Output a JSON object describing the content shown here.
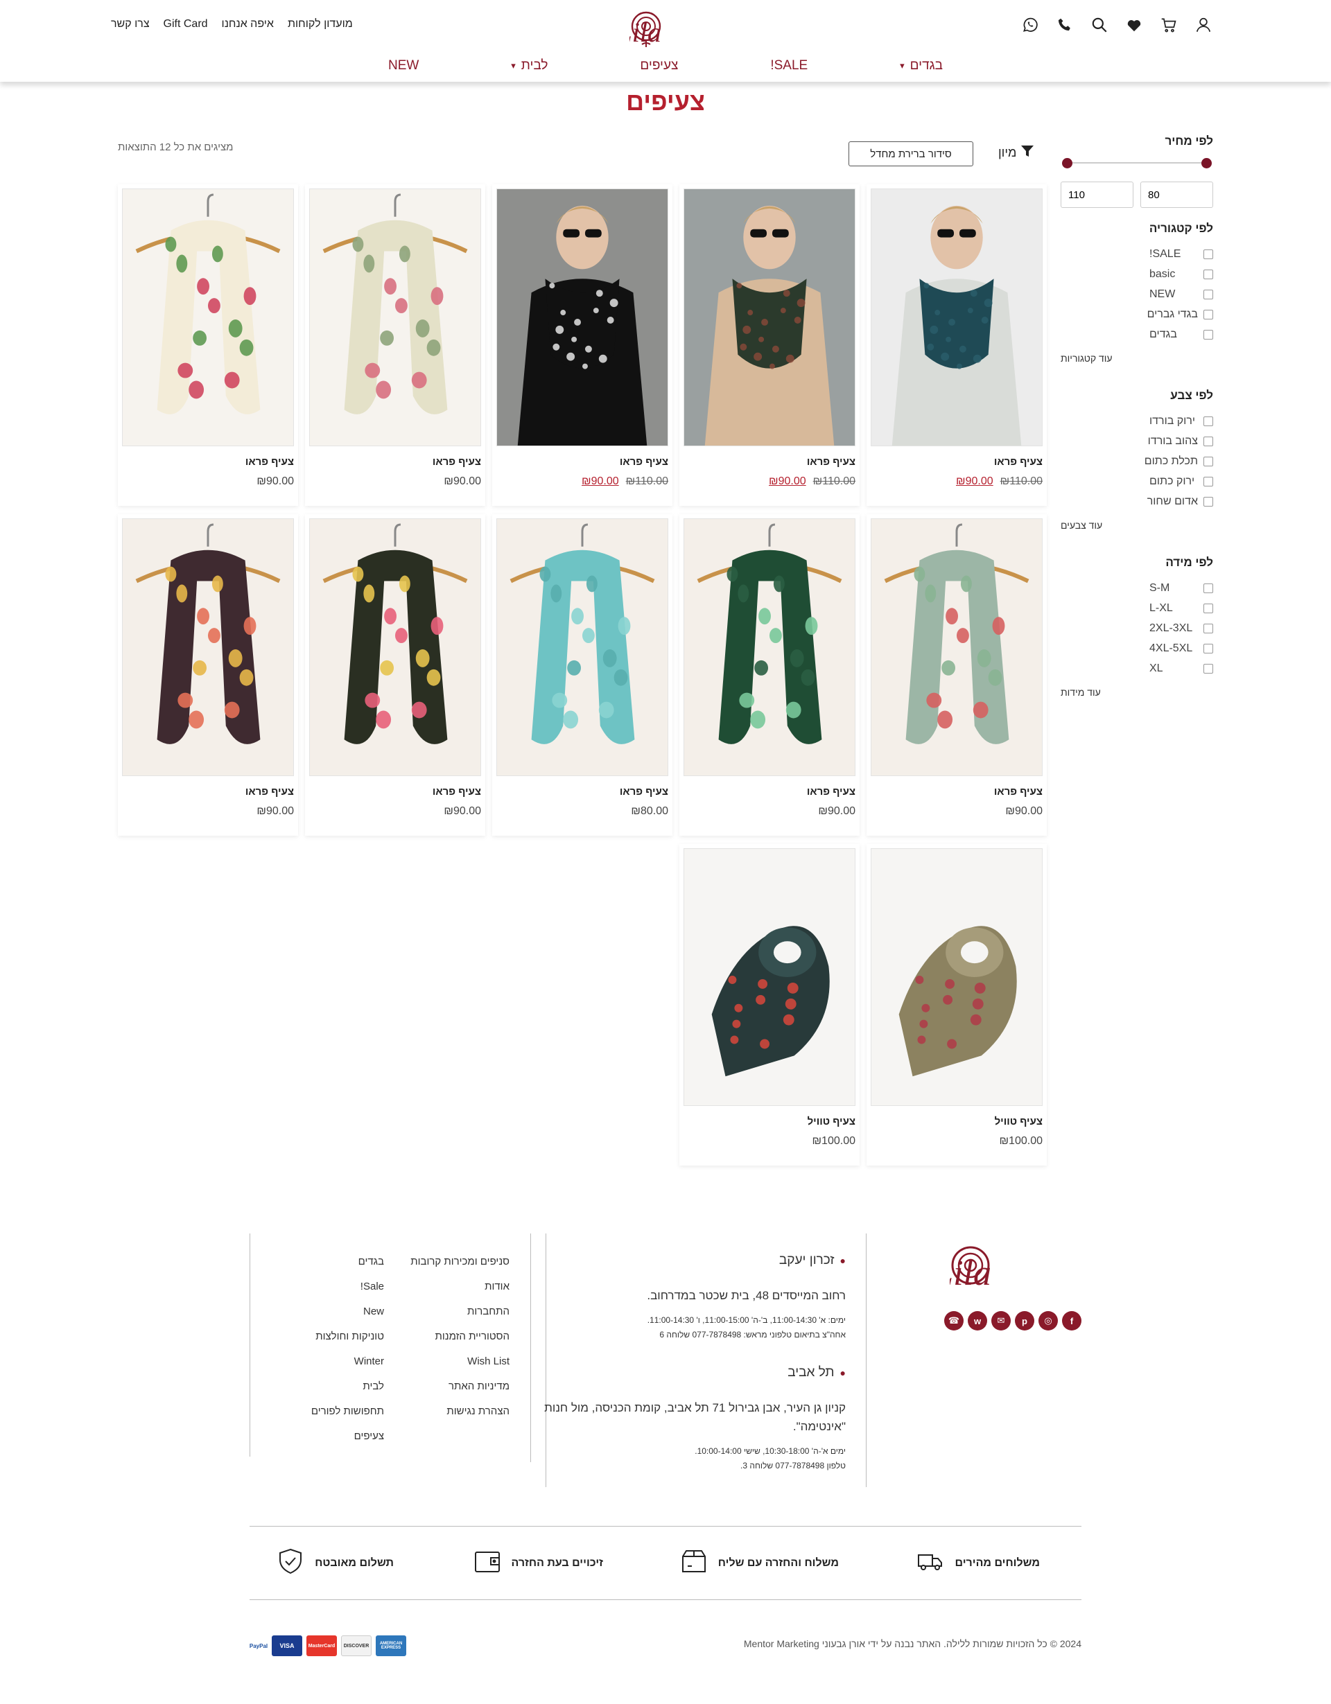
{
  "header": {
    "logo_text": "Lila",
    "util_links": [
      "מועדון לקוחות",
      "איפה אנחנו",
      "Gift Card",
      "צרו קשר"
    ],
    "nav": [
      {
        "label": "בגדים",
        "dropdown": true
      },
      {
        "label": "SALE!",
        "dropdown": false
      },
      {
        "label": "צעיפים",
        "dropdown": false
      },
      {
        "label": "לבית",
        "dropdown": true
      },
      {
        "label": "NEW",
        "dropdown": false
      }
    ],
    "icons": [
      "user-icon",
      "cart-icon",
      "heart-icon",
      "search-icon",
      "phone-icon",
      "whatsapp-icon"
    ]
  },
  "page": {
    "title": "צעיפים",
    "results_count": "מציגים את כל 12 התוצאות",
    "sort_label": "מיון",
    "sort_value": "סידור ברירת מחדל"
  },
  "filters": {
    "price": {
      "title": "לפי מחיר",
      "min": "80",
      "max": "110"
    },
    "category": {
      "title": "לפי קטגוריה",
      "items": [
        "SALE!",
        "basic",
        "NEW",
        "בגדי גברים",
        "בגדים"
      ],
      "more": "עוד קטגוריות"
    },
    "color": {
      "title": "לפי צבע",
      "items": [
        "ירוק בורדו",
        "צהוב בורדו",
        "תכלת כתום",
        "ירוק כתום",
        "אדום שחור"
      ],
      "more": "עוד צבעים"
    },
    "size": {
      "title": "לפי מידה",
      "items": [
        "S-M",
        "L-XL",
        "2XL-3XL",
        "4XL-5XL",
        "XL"
      ],
      "more": "עוד מידות"
    }
  },
  "products": [
    {
      "name": "צעיף פראו",
      "old_price": "₪110.00",
      "price": "₪90.00",
      "on_sale": true,
      "image": "teal dotted scarf on model"
    },
    {
      "name": "צעיף פראו",
      "old_price": "₪110.00",
      "price": "₪90.00",
      "on_sale": true,
      "image": "floral print scarf on model"
    },
    {
      "name": "צעיף פראו",
      "old_price": "₪110.00",
      "price": "₪90.00",
      "on_sale": true,
      "image": "black white checked scarf on model"
    },
    {
      "name": "צעיף פראו",
      "old_price": "",
      "price": "₪90.00",
      "on_sale": false,
      "image": "cream floral scarf on hanger"
    },
    {
      "name": "צעיף פראו",
      "old_price": "",
      "price": "₪90.00",
      "on_sale": false,
      "image": "pink rose scarf on hanger"
    },
    {
      "name": "צעיף פראו",
      "old_price": "",
      "price": "₪90.00",
      "on_sale": false,
      "image": "mint floral scarf on hanger"
    },
    {
      "name": "צעיף פראו",
      "old_price": "",
      "price": "₪90.00",
      "on_sale": false,
      "image": "dark green floral scarf on hanger"
    },
    {
      "name": "צעיף פראו",
      "old_price": "",
      "price": "₪80.00",
      "on_sale": false,
      "image": "turquoise scarf on hanger"
    },
    {
      "name": "צעיף פראו",
      "old_price": "",
      "price": "₪90.00",
      "on_sale": false,
      "image": "geometric pink yellow scarf on hanger"
    },
    {
      "name": "צעיף פראו",
      "old_price": "",
      "price": "₪90.00",
      "on_sale": false,
      "image": "geometric dark scarf on hanger"
    },
    {
      "name": "צעיף טוויל",
      "old_price": "",
      "price": "₪100.00",
      "on_sale": false,
      "image": "olive floral twill scarf"
    },
    {
      "name": "צעיף טוויל",
      "old_price": "",
      "price": "₪100.00",
      "on_sale": false,
      "image": "dark floral twill scarf"
    }
  ],
  "footer": {
    "logo_text": "Lila",
    "socials": [
      "facebook-icon",
      "instagram-icon",
      "pinterest-icon",
      "email-icon",
      "whatsapp-icon",
      "phone-icon"
    ],
    "stores": [
      {
        "city": "זכרון יעקב",
        "address": "רחוב המייסדים 48, בית שכטר במדרחוב.",
        "hours": "ימים: א' 11:00-14:30, ב'-ה' 11:00-15:00, ו' 11:00-14:30.",
        "phone": "אחה\"צ בתיאום טלפוני מראש: 077-7878498 שלוחה 6"
      },
      {
        "city": "תל אביב",
        "address": "קניון גן העיר, אבן גבירול 71 תל אביב, קומת הכניסה, מול חנות \"אינטימה\".",
        "hours": "ימים א'-ה' 10:30-18:00, שישי 10:00-14:00.",
        "phone": "טלפון 077-7878498 שלוחה 3."
      }
    ],
    "links_col1": [
      "סניפים ומכירות קרובות",
      "אודות",
      "התחברות",
      "הסטוריית הזמנות",
      "Wish List",
      "מדיניות האתר",
      "הצהרת נגישות"
    ],
    "links_col2": [
      "בגדים",
      "Sale!",
      "New",
      "טוניקות וחולצות",
      "Winter",
      "לבית",
      "תחפושות לפורים",
      "צעיפים"
    ],
    "features": [
      "משלוחים מהירים",
      "משלוח והחזרה עם שליח",
      "זיכויים בעת החזרה",
      "תשלום מאובטח"
    ],
    "copyright": "2024 © כל הזכויות שמורות ללילה. האתר נבנה על ידי אורן גבעוני Mentor Marketing",
    "payments": [
      "AMERICAN EXPRESS",
      "DISCOVER",
      "MasterCard",
      "VISA",
      "PayPal"
    ]
  },
  "colors": {
    "brand": "#8a1a2a",
    "title": "#b5202e"
  }
}
